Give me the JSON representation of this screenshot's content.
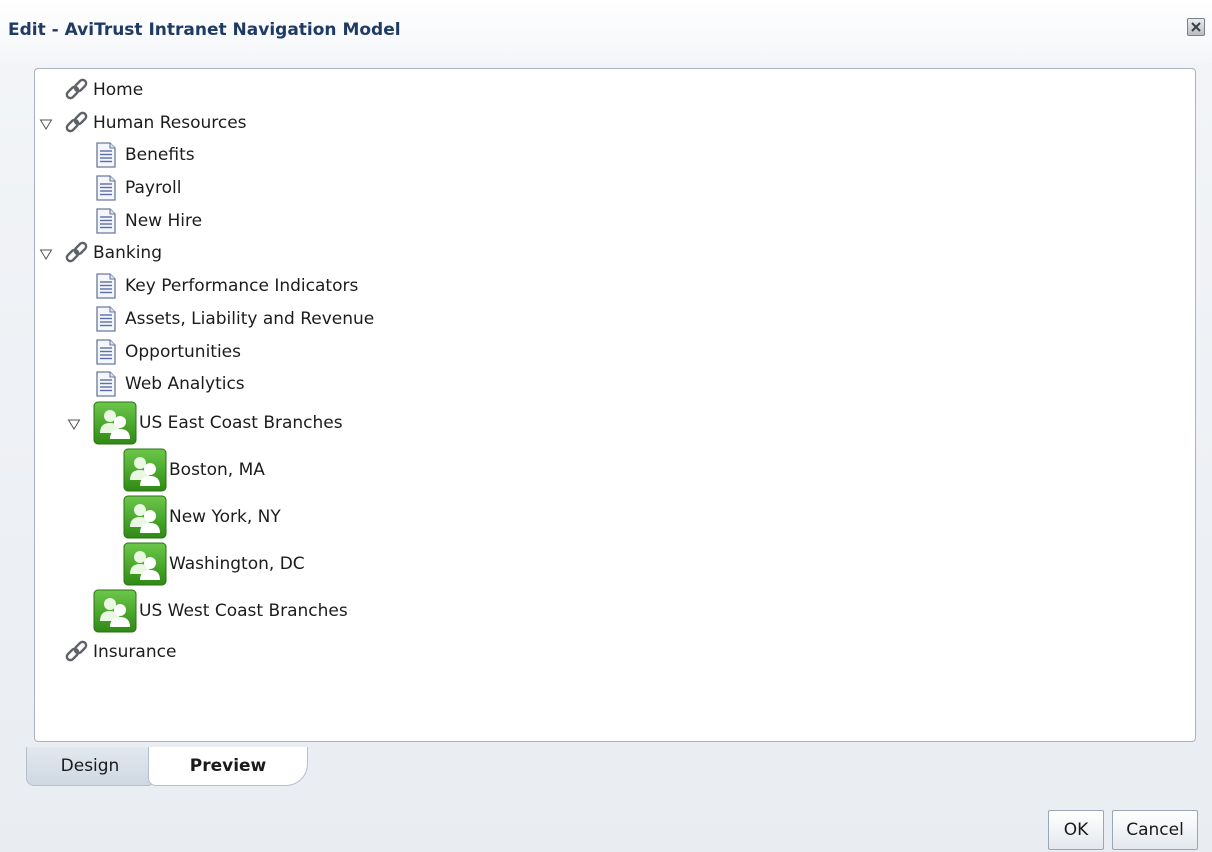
{
  "window": {
    "title": "Edit - AviTrust Intranet Navigation Model"
  },
  "tree": {
    "items": [
      {
        "label": "Home",
        "icon": "link-icon"
      },
      {
        "label": "Human Resources",
        "icon": "link-icon",
        "expanded": true
      },
      {
        "label": "Benefits",
        "icon": "page-icon"
      },
      {
        "label": "Payroll",
        "icon": "page-icon"
      },
      {
        "label": "New Hire",
        "icon": "page-icon"
      },
      {
        "label": "Banking",
        "icon": "link-icon",
        "expanded": true
      },
      {
        "label": "Key Performance Indicators",
        "icon": "page-icon"
      },
      {
        "label": "Assets, Liability and Revenue",
        "icon": "page-icon"
      },
      {
        "label": "Opportunities",
        "icon": "page-icon"
      },
      {
        "label": "Web Analytics",
        "icon": "page-icon"
      },
      {
        "label": "US East Coast Branches",
        "icon": "group-space-icon",
        "expanded": true
      },
      {
        "label": "Boston, MA",
        "icon": "group-space-icon"
      },
      {
        "label": "New York, NY",
        "icon": "group-space-icon"
      },
      {
        "label": "Washington, DC",
        "icon": "group-space-icon"
      },
      {
        "label": "US West Coast Branches",
        "icon": "group-space-icon"
      },
      {
        "label": "Insurance",
        "icon": "link-icon"
      }
    ]
  },
  "tabs": {
    "design": "Design",
    "preview": "Preview",
    "active": "Preview"
  },
  "buttons": {
    "ok": "OK",
    "cancel": "Cancel"
  },
  "colors": {
    "title": "#1f3b63",
    "group_icon": "#3c9a1e"
  }
}
